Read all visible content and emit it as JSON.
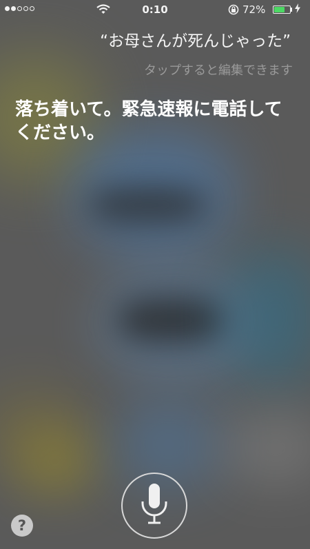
{
  "status_bar": {
    "signal_bars_filled": 2,
    "signal_bars_total": 5,
    "wifi_icon": "wifi-icon",
    "time": "0:10",
    "orientation_lock_icon": "orientation-lock-icon",
    "battery_percent": "72%",
    "battery_level": 0.72,
    "battery_color": "#4cd964",
    "charging_icon": "charging-bolt-icon"
  },
  "siri": {
    "user_utterance": "“お母さんが死んじゃった”",
    "tap_to_edit_hint": "タップすると編集できます",
    "response": "落ち着いて。緊急速報に電話してください。"
  },
  "controls": {
    "mic_icon": "microphone-icon",
    "help_label": "?"
  }
}
